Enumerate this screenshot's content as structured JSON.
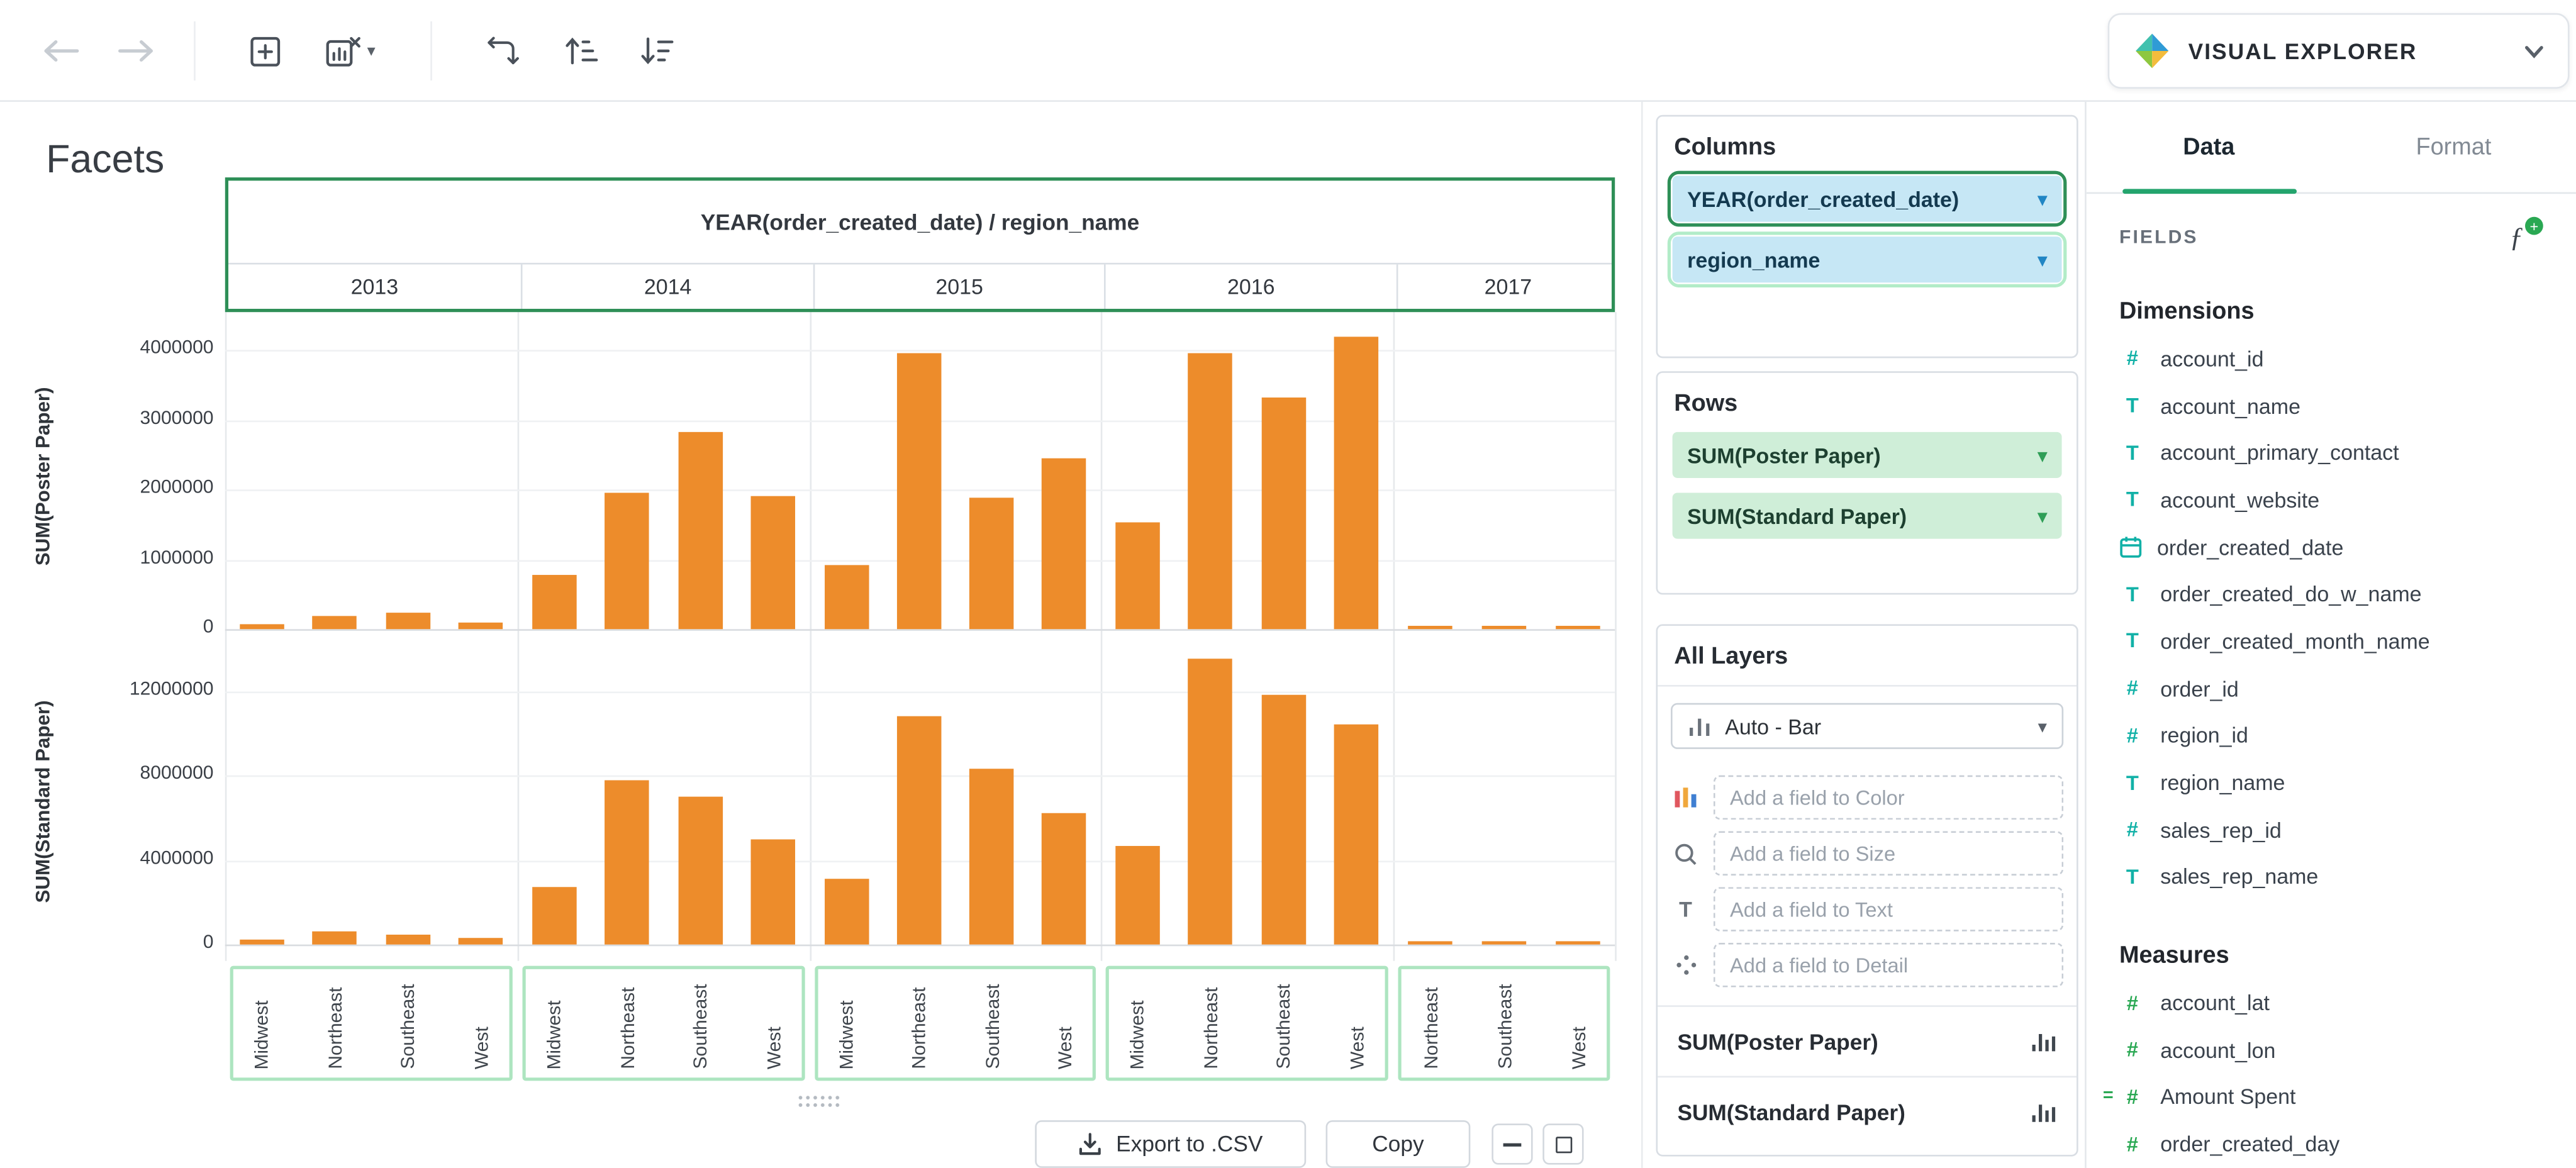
{
  "brand": {
    "title": "VISUAL EXPLORER",
    "icon": "diamond-logo-icon"
  },
  "page": {
    "title": "Facets"
  },
  "toolbar": {
    "icons": [
      "back-arrow",
      "forward-arrow",
      "add-chart",
      "remove-chart",
      "flip-axes",
      "sort-ascending",
      "sort-descending"
    ]
  },
  "footer": {
    "export_label": "Export to .CSV",
    "copy_label": "Copy"
  },
  "colors": {
    "accent_green": "#24a46d",
    "selection_dark_green": "#2e8f57",
    "selection_light_green": "#ade5c0",
    "bar_orange": "#ED8C2B",
    "pill_blue_bg": "#c6e7f5",
    "pill_green_bg": "#cfeed8",
    "dimension_teal": "#12b1a7",
    "measure_green": "#2aa853"
  },
  "columns_panel": {
    "title": "Columns",
    "pills": [
      {
        "label": "YEAR(order_created_date)",
        "color": "blue",
        "selection": "primary"
      },
      {
        "label": "region_name",
        "color": "blue",
        "selection": "secondary"
      }
    ]
  },
  "rows_panel": {
    "title": "Rows",
    "pills": [
      {
        "label": "SUM(Poster Paper)",
        "color": "green",
        "selection": ""
      },
      {
        "label": "SUM(Standard Paper)",
        "color": "green",
        "selection": ""
      }
    ]
  },
  "layers_panel": {
    "title": "All Layers",
    "layer_type": "Auto - Bar",
    "field_slots": [
      {
        "icon": "color-icon",
        "placeholder": "Add a field to Color"
      },
      {
        "icon": "size-icon",
        "placeholder": "Add a field to Size"
      },
      {
        "icon": "text-icon",
        "placeholder": "Add a field to Text"
      },
      {
        "icon": "detail-icon",
        "placeholder": "Add a field to Detail"
      }
    ],
    "measures": [
      "SUM(Poster Paper)",
      "SUM(Standard Paper)"
    ]
  },
  "fields_panel": {
    "tabs": [
      {
        "label": "Data",
        "active": true
      },
      {
        "label": "Format",
        "active": false
      }
    ],
    "header": "FIELDS",
    "add_function_icon": "fx-add-icon",
    "sections": [
      {
        "title": "Dimensions",
        "items": [
          {
            "name": "account_id",
            "icon": "number"
          },
          {
            "name": "account_name",
            "icon": "text"
          },
          {
            "name": "account_primary_contact",
            "icon": "text"
          },
          {
            "name": "account_website",
            "icon": "text"
          },
          {
            "name": "order_created_date",
            "icon": "date"
          },
          {
            "name": "order_created_do_w_name",
            "icon": "text"
          },
          {
            "name": "order_created_month_name",
            "icon": "text"
          },
          {
            "name": "order_id",
            "icon": "number"
          },
          {
            "name": "region_id",
            "icon": "number"
          },
          {
            "name": "region_name",
            "icon": "text"
          },
          {
            "name": "sales_rep_id",
            "icon": "number"
          },
          {
            "name": "sales_rep_name",
            "icon": "text"
          }
        ]
      },
      {
        "title": "Measures",
        "items": [
          {
            "name": "account_lat",
            "icon": "number"
          },
          {
            "name": "account_lon",
            "icon": "number"
          },
          {
            "name": "Amount Spent",
            "icon": "calc-number"
          },
          {
            "name": "order_created_day",
            "icon": "number"
          }
        ]
      }
    ]
  },
  "chart_data": {
    "type": "bar",
    "title": "Facets",
    "facet_title": "YEAR(order_created_date) / region_name",
    "bar_color": "#ED8C2B",
    "grid": true,
    "facets": [
      {
        "year": "2013",
        "categories": [
          "Midwest",
          "Northeast",
          "Southeast",
          "West"
        ]
      },
      {
        "year": "2014",
        "categories": [
          "Midwest",
          "Northeast",
          "Southeast",
          "West"
        ]
      },
      {
        "year": "2015",
        "categories": [
          "Midwest",
          "Northeast",
          "Southeast",
          "West"
        ]
      },
      {
        "year": "2016",
        "categories": [
          "Midwest",
          "Northeast",
          "Southeast",
          "West"
        ]
      },
      {
        "year": "2017",
        "categories": [
          "Northeast",
          "Southeast",
          "West"
        ]
      }
    ],
    "rows": [
      {
        "name": "SUM(Poster Paper)",
        "ylim": [
          0,
          4400000
        ],
        "yticks": [
          0,
          1000000,
          2000000,
          3000000,
          4000000
        ],
        "values": {
          "2013": [
            60000,
            200000,
            230000,
            90000
          ],
          "2014": [
            780000,
            1950000,
            2820000,
            1900000
          ],
          "2015": [
            920000,
            3950000,
            1880000,
            2450000
          ],
          "2016": [
            1530000,
            3950000,
            3320000,
            4200000
          ],
          "2017": [
            30000,
            30000,
            25000
          ]
        }
      },
      {
        "name": "SUM(Standard Paper)",
        "ylim": [
          0,
          13600000
        ],
        "yticks": [
          0,
          4000000,
          8000000,
          12000000
        ],
        "values": {
          "2013": [
            250000,
            600000,
            500000,
            320000
          ],
          "2014": [
            2700000,
            7800000,
            7000000,
            5000000
          ],
          "2015": [
            3100000,
            10800000,
            8300000,
            6200000
          ],
          "2016": [
            4700000,
            13500000,
            11800000,
            10400000
          ],
          "2017": [
            120000,
            150000,
            100000
          ]
        }
      }
    ]
  }
}
